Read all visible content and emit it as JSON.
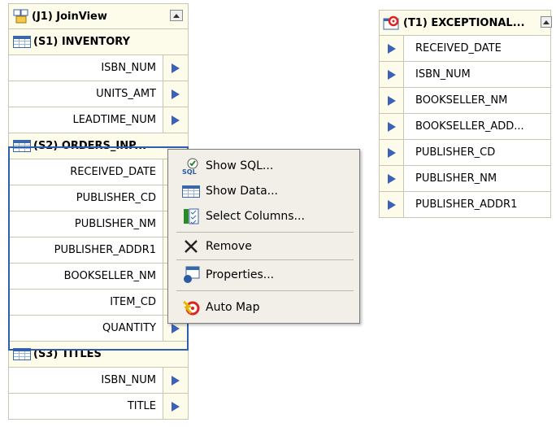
{
  "joinview": {
    "title": "(J1) JoinView",
    "sources": [
      {
        "title": "(S1) INVENTORY",
        "columns": [
          "ISBN_NUM",
          "UNITS_AMT",
          "LEADTIME_NUM"
        ]
      },
      {
        "title": "(S2) ORDERS_INP...",
        "columns": [
          "RECEIVED_DATE",
          "PUBLISHER_CD",
          "PUBLISHER_NM",
          "PUBLISHER_ADDR1",
          "BOOKSELLER_NM",
          "ITEM_CD",
          "QUANTITY"
        ]
      },
      {
        "title": "(S3) TITLES",
        "columns": [
          "ISBN_NUM",
          "TITLE"
        ]
      }
    ]
  },
  "context_menu": {
    "items": [
      {
        "label": "Show SQL...",
        "icon": "sql-icon"
      },
      {
        "label": "Show Data...",
        "icon": "table-icon"
      },
      {
        "label": "Select Columns...",
        "icon": "select-columns-icon"
      },
      {
        "label": "Remove",
        "icon": "remove-x-icon"
      },
      {
        "label": "Properties...",
        "icon": "properties-icon"
      },
      {
        "label": "Auto Map",
        "icon": "auto-map-icon"
      }
    ]
  },
  "target": {
    "title": "(T1) EXCEPTIONAL...",
    "columns": [
      "RECEIVED_DATE",
      "ISBN_NUM",
      "BOOKSELLER_NM",
      "BOOKSELLER_ADD...",
      "PUBLISHER_CD",
      "PUBLISHER_NM",
      "PUBLISHER_ADDR1"
    ]
  },
  "colors": {
    "port_arrow": "#3b62b8",
    "selection_border": "#2f5db0",
    "header_bg": "#fdfbea"
  }
}
